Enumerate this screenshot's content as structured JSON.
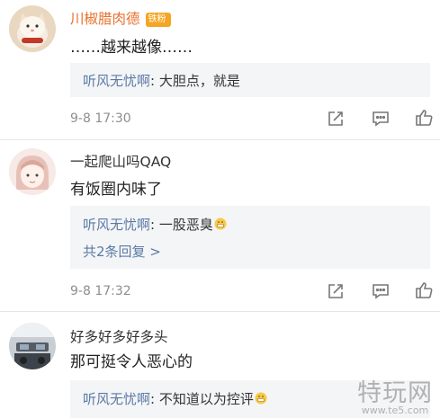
{
  "comments": [
    {
      "username": "川椒腊肉德",
      "badge": "铁粉",
      "text": "……越来越像……",
      "reply_user": "听风无忧啊",
      "reply_text": ": 大胆点，就是",
      "more_replies": "",
      "time": "9-8 17:30"
    },
    {
      "username": "一起爬山吗QAQ",
      "text": "有饭圈内味了",
      "reply_user": "听风无忧啊",
      "reply_text": ": 一股恶臭",
      "more_replies": "共2条回复 >",
      "time": "9-8 17:32"
    },
    {
      "username": "好多好多好多头",
      "text": "那可挺令人恶心的",
      "reply_user": "听风无忧啊",
      "reply_text": ": 不知道以为控评"
    }
  ],
  "watermark": {
    "main": "特玩网",
    "sub": "www.te5.com"
  },
  "colors": {
    "username": "#e8712c",
    "link": "#5a7aa5",
    "meta": "#8e8e8e",
    "reply_bg": "#f4f5f7"
  },
  "icons": [
    "repost-icon",
    "comment-icon",
    "like-icon",
    "grimace-emoji-icon"
  ]
}
